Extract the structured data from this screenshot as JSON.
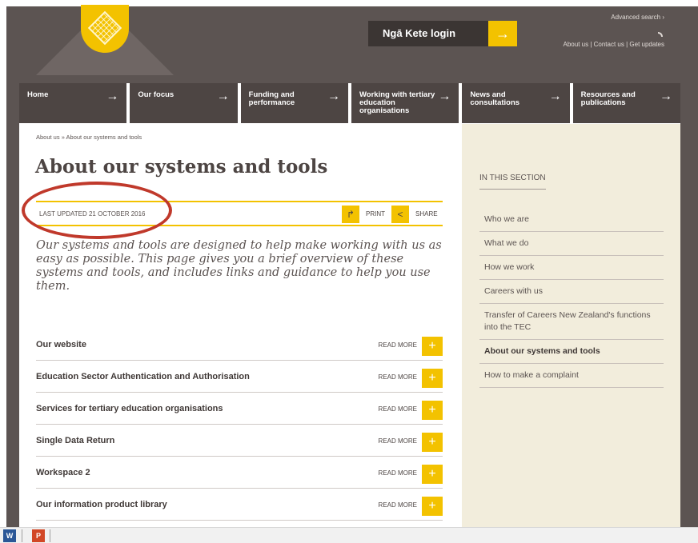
{
  "header": {
    "login_label": "Ngā Kete login",
    "login_arrow": "→",
    "advanced_search": "Advanced search ›",
    "rss_label": "",
    "util_links": {
      "about": "About us",
      "sep1": " | ",
      "contact": "Contact us",
      "sep2": " | ",
      "updates": "Get updates"
    }
  },
  "nav": {
    "items": [
      {
        "label": "Home",
        "arrow": "→"
      },
      {
        "label": "Our focus",
        "arrow": "→"
      },
      {
        "label": "Funding and performance",
        "arrow": "→"
      },
      {
        "label": "Working with tertiary education organisations",
        "arrow": "→"
      },
      {
        "label": "News and consultations",
        "arrow": "→"
      },
      {
        "label": "Resources and publications",
        "arrow": "→"
      }
    ]
  },
  "main": {
    "breadcrumb": "About us » About our systems and tools",
    "title": "About our systems and tools",
    "updated": "LAST UPDATED 21 OCTOBER 2016",
    "print_label": "PRINT",
    "share_label": "SHARE",
    "print_glyph": "↱",
    "share_glyph": "<",
    "intro": "Our systems and tools are designed to help make working with us as easy as possible. This page gives you a brief overview of these systems and tools, and includes links and guidance to help you use them.",
    "read_more": "READ MORE",
    "plus": "+",
    "sections": [
      "Our website",
      "Education Sector Authentication and Authorisation",
      "Services for tertiary education organisations",
      "Single Data Return",
      "Workspace 2",
      "Our information product library"
    ]
  },
  "sidebar": {
    "heading": "IN THIS SECTION",
    "items": [
      "Who we are",
      "What we do",
      "How we work",
      "Careers with us",
      "Transfer of Careers New Zealand's functions into the TEC",
      "About our systems and tools",
      "How to make a complaint"
    ]
  },
  "taskbar": {
    "word_glyph": "W",
    "ppt_glyph": "P"
  },
  "colors": {
    "brand_dark": "#5c5452",
    "accent_yellow": "#f3c200",
    "sidebar_bg": "#f2eddc",
    "annotation_red": "#c0392b"
  }
}
